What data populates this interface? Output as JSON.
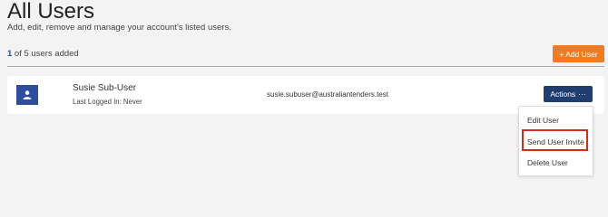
{
  "page": {
    "title": "All Users",
    "subtitle": "Add, edit, remove and manage your account's listed users."
  },
  "summary": {
    "count": "1",
    "suffix": " of 5 users added"
  },
  "toolbar": {
    "add_user_label": "+ Add User"
  },
  "users": [
    {
      "name": "Susie Sub-User",
      "last_login": "Last Logged In: Never",
      "email": "susie.subuser@australiantenders.test",
      "actions_label": "Actions",
      "actions_icon": "ellipsis-icon"
    }
  ],
  "actions_menu": {
    "items": [
      "Edit User",
      "Send User Invite",
      "Delete User"
    ],
    "highlighted": "Send User Invite",
    "highlight_color": "#d9291b"
  },
  "colors": {
    "add_button": "#f07b22",
    "actions_button": "#1f3d6e",
    "avatar": "#2b4f9e",
    "count_accent": "#1e4fa3"
  }
}
